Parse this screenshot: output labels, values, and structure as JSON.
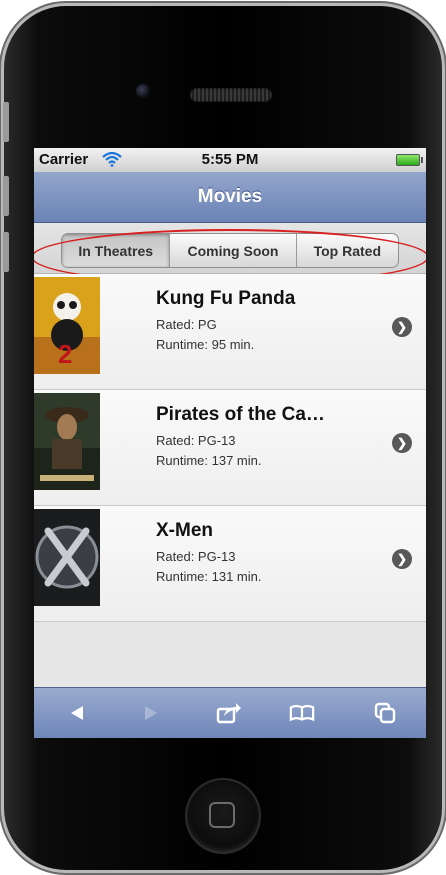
{
  "status_bar": {
    "carrier": "Carrier",
    "time": "5:55 PM"
  },
  "nav": {
    "title": "Movies"
  },
  "segments": [
    {
      "label": "In Theatres",
      "selected": true
    },
    {
      "label": "Coming Soon",
      "selected": false
    },
    {
      "label": "Top Rated",
      "selected": false
    }
  ],
  "movies": [
    {
      "title": "Kung Fu Panda",
      "rated": "Rated: PG",
      "runtime": "Runtime: 95 min.",
      "poster_icon": "kung-fu-panda-poster"
    },
    {
      "title": "Pirates of the Ca…",
      "rated": "Rated: PG-13",
      "runtime": "Runtime: 137 min.",
      "poster_icon": "pirates-poster"
    },
    {
      "title": "X-Men",
      "rated": "Rated: PG-13",
      "runtime": "Runtime: 131 min.",
      "poster_icon": "x-men-poster"
    }
  ],
  "toolbar": {
    "icons": [
      "back-arrow-icon",
      "forward-arrow-icon",
      "share-icon",
      "bookmarks-icon",
      "tabs-icon"
    ]
  },
  "colors": {
    "highlight_outline": "#d82020",
    "navbar": "#7b91bf",
    "toolbar": "#7d93c2"
  }
}
